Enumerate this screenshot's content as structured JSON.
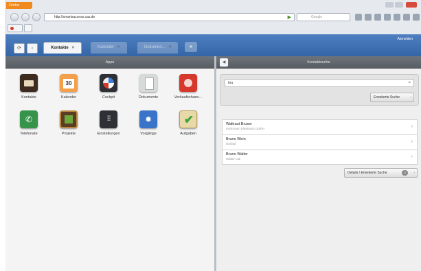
{
  "browser": {
    "app_button": "Firefox",
    "url": "http://smartsuccess.cas.de",
    "search_placeholder": "Google"
  },
  "app_header": {
    "tabs": [
      {
        "label": "Kontakte",
        "close": "×"
      },
      {
        "label": "Kalender",
        "close": "×"
      },
      {
        "label": "Dokumen...",
        "close": "×"
      }
    ],
    "add_tab": "+",
    "user": "Abmelden"
  },
  "apps_panel": {
    "title": "Apps",
    "items": [
      {
        "label": "Kontakte",
        "icon": "contacts-icon"
      },
      {
        "label": "Kalender",
        "icon": "calendar-icon",
        "glyph": "30"
      },
      {
        "label": "Cockpit",
        "icon": "cockpit-icon"
      },
      {
        "label": "Dokumente",
        "icon": "documents-icon"
      },
      {
        "label": "Verkaufschanc...",
        "icon": "sales-opportunities-icon"
      },
      {
        "label": "Telefonate",
        "icon": "phone-icon",
        "glyph": "✆"
      },
      {
        "label": "Projekte",
        "icon": "projects-icon"
      },
      {
        "label": "Einstellungen",
        "icon": "settings-sliders-icon",
        "glyph": "⫶⫶⫶"
      },
      {
        "label": "Vorgänge",
        "icon": "processes-gear-icon",
        "glyph": "✹"
      },
      {
        "label": "Aufgaben",
        "icon": "tasks-checkmark-icon",
        "glyph": "✔"
      }
    ]
  },
  "search_panel": {
    "title": "Kontaktsuche",
    "query": "bru",
    "clear": "×",
    "advanced_button": "Erweiterte Suche",
    "results": [
      {
        "name": "Waltraut Bruser",
        "subtitle": "Kuhrmann Elektronic GmbH"
      },
      {
        "name": "Bruno Wein",
        "subtitle": "Norlauf"
      },
      {
        "name": "Bruno Walter",
        "subtitle": "Walter Ltd."
      }
    ],
    "details_button": "Details / Erweiterte Suche",
    "details_badge": "3"
  }
}
